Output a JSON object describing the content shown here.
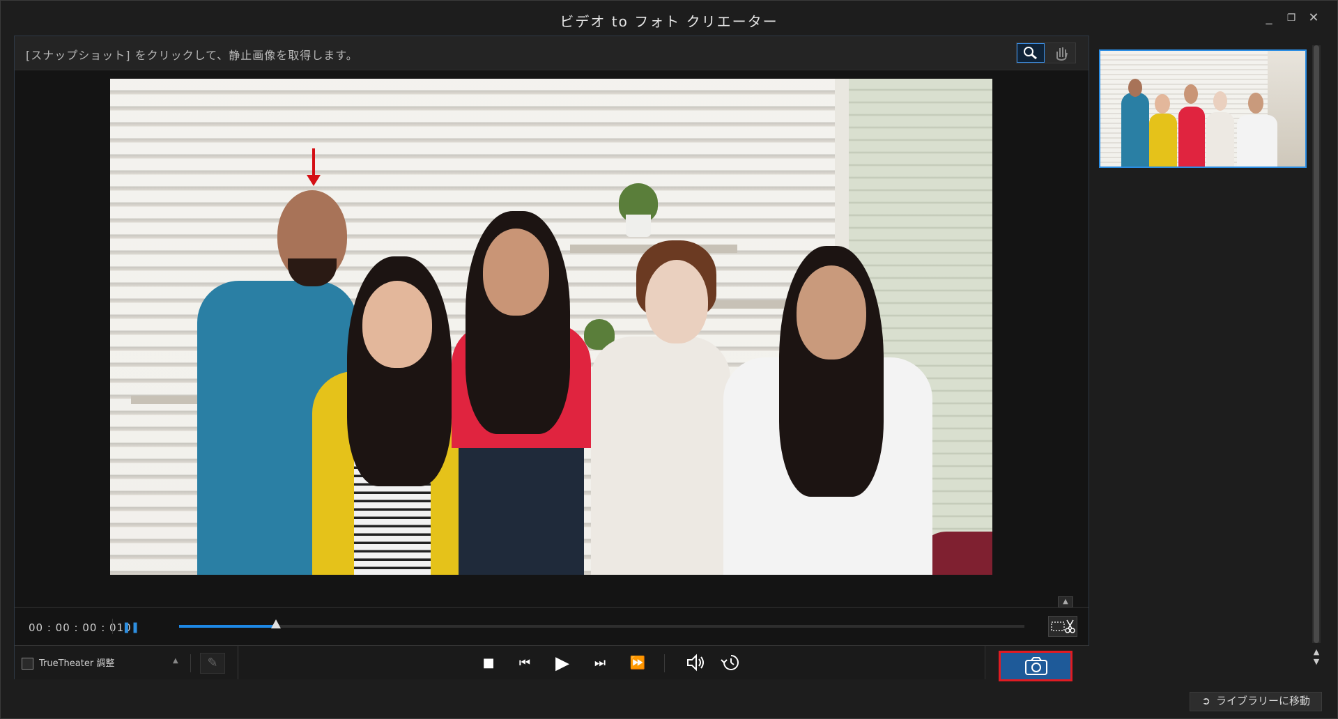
{
  "window": {
    "title": "ビデオ to フォト クリエーター",
    "controls": {
      "minimize_icon": "minimize-icon",
      "restore_icon": "restore-icon",
      "close_icon": "close-icon"
    }
  },
  "infobar": {
    "instruction": "[スナップショット] をクリックして、静止画像を取得します。",
    "tools": [
      {
        "name": "zoom-tool",
        "icon": "magnifier-icon",
        "active": true
      },
      {
        "name": "pan-tool",
        "icon": "hand-icon",
        "active": false
      }
    ]
  },
  "viewer": {
    "annotation_arrow_color": "#d40f14"
  },
  "timeline": {
    "timecode": "00 : 00 : 00 : 010",
    "progress_fraction": 0.115,
    "accent_color": "#1e88e5"
  },
  "controls": {
    "truetheater_label": "TrueTheater 調整",
    "buttons": [
      "stop",
      "previous-frame",
      "play",
      "next-frame",
      "fast-forward",
      "volume",
      "speed"
    ]
  },
  "snapshot": {
    "highlight_color": "#e11b22",
    "button_color": "#1e5a99"
  },
  "footer": {
    "library_button_label": "ライブラリーに移動"
  }
}
